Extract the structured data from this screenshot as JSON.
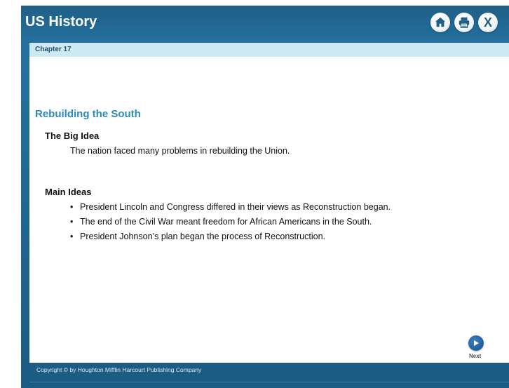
{
  "app": {
    "title": "US History"
  },
  "toolbar": {
    "home_icon": "home-icon",
    "print_icon": "print-icon",
    "close_icon": "close-icon",
    "close_label": "X"
  },
  "chapter": {
    "label": "Chapter 17"
  },
  "lesson": {
    "title": "Rebuilding the South",
    "big_idea_heading": "The Big Idea",
    "big_idea_text": "The nation faced many problems in rebuilding the Union.",
    "main_ideas_heading": "Main Ideas",
    "main_ideas": [
      "President Lincoln and Congress differed in their views as Reconstruction began.",
      "The end of the Civil War meant freedom for African Americans in the South.",
      "President Johnson’s plan began the process of Reconstruction."
    ],
    "bullet": "•"
  },
  "navigation": {
    "next_label": "Next",
    "next_icon": "play-arrow-icon"
  },
  "footer": {
    "copyright": "Copyright © by Houghton Mifflin Harcourt Publishing Company"
  },
  "colors": {
    "header_bg": "#1f5f86",
    "chapter_bar_bg": "#cde9f3",
    "title_blue": "#2b8ab8"
  }
}
